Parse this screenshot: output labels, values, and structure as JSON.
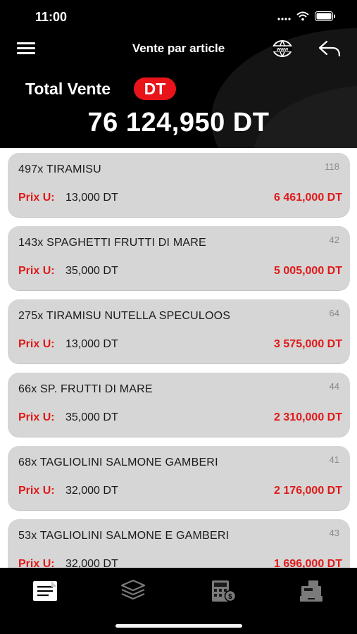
{
  "status_bar": {
    "time": "11:00"
  },
  "nav": {
    "title": "Vente par article",
    "menu_icon": "hamburger-menu-icon",
    "web_icon": "www-globe-icon",
    "back_icon": "reply-back-icon"
  },
  "summary": {
    "label": "Total Vente",
    "currency_badge": "DT",
    "total": "76 124,950 DT"
  },
  "items": [
    {
      "title": "497x TIRAMISU",
      "count": "118",
      "unit_label": "Prix U:",
      "unit_price": "13,000 DT",
      "total": "6 461,000 DT"
    },
    {
      "title": "143x SPAGHETTI FRUTTI DI MARE",
      "count": "42",
      "unit_label": "Prix U:",
      "unit_price": "35,000 DT",
      "total": "5 005,000 DT"
    },
    {
      "title": "275x TIRAMISU NUTELLA SPECULOOS",
      "count": "64",
      "unit_label": "Prix U:",
      "unit_price": "13,000 DT",
      "total": "3 575,000 DT"
    },
    {
      "title": "66x SP. FRUTTI DI MARE",
      "count": "44",
      "unit_label": "Prix U:",
      "unit_price": "35,000 DT",
      "total": "2 310,000 DT"
    },
    {
      "title": "68x TAGLIOLINI SALMONE GAMBERI",
      "count": "41",
      "unit_label": "Prix U:",
      "unit_price": "32,000 DT",
      "total": "2 176,000 DT"
    },
    {
      "title": "53x TAGLIOLINI SALMONE E GAMBERI",
      "count": "43",
      "unit_label": "Prix U:",
      "unit_price": "32,000 DT",
      "total": "1 696,000 DT"
    }
  ],
  "tabbar": {
    "tabs": [
      {
        "icon": "document-icon",
        "active": true
      },
      {
        "icon": "layers-icon",
        "active": false
      },
      {
        "icon": "calculator-icon",
        "active": false
      },
      {
        "icon": "cash-register-icon",
        "active": false
      }
    ]
  },
  "colors": {
    "accent_red": "#e01919",
    "badge_red": "#e8141a",
    "header_bg": "#000000",
    "card_bg": "#d6d6d6"
  }
}
